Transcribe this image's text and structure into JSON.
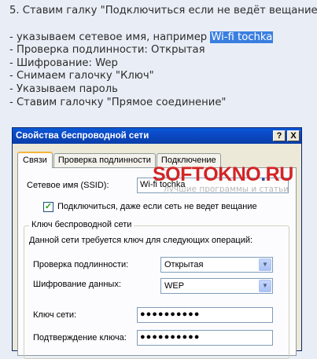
{
  "instructions": {
    "title": "5. Ставим галку \"Подключиться если не ведёт вещание\"",
    "line1_prefix": "- указываем сетевое имя, например ",
    "line1_highlight": "Wi-fi tochka",
    "line2": "- Проверка подлинности: Открытая",
    "line3": "- Шифрование: Wep",
    "line4": "- Снимаем галочку \"Ключ\"",
    "line5": "- Указываем пароль",
    "line6": "- Ставим галочку \"Прямое соединение\""
  },
  "dialog": {
    "title": "Свойства беспроводной сети",
    "help_button": "?",
    "close_button": "X",
    "tabs": [
      "Связи",
      "Проверка подлинности",
      "Подключение"
    ],
    "ssid_label": "Сетевое имя (SSID):",
    "ssid_value": "Wi-fi tochka",
    "broadcast_checkbox_label": "Подключиться, даже если сеть не ведет вещание",
    "broadcast_checkbox_mark": "✓",
    "group_title": "Ключ беспроводной сети",
    "group_description": "Данной сети требуется ключ для следующих операций:",
    "auth_label": "Проверка подлинности:",
    "auth_value": "Открытая",
    "encryption_label": "Шифрование данных:",
    "encryption_value": "WEP",
    "key_label": "Ключ сети:",
    "key_value": "●●●●●●●●●●",
    "confirm_label": "Подтверждение ключа:",
    "confirm_value": "●●●●●●●●●●",
    "dropdown_arrow": "▼"
  },
  "watermark": {
    "brand_left": "SOFTOKNO",
    "brand_dot": ".",
    "brand_right": "RU",
    "tagline": "лучшие программы и статьи"
  }
}
